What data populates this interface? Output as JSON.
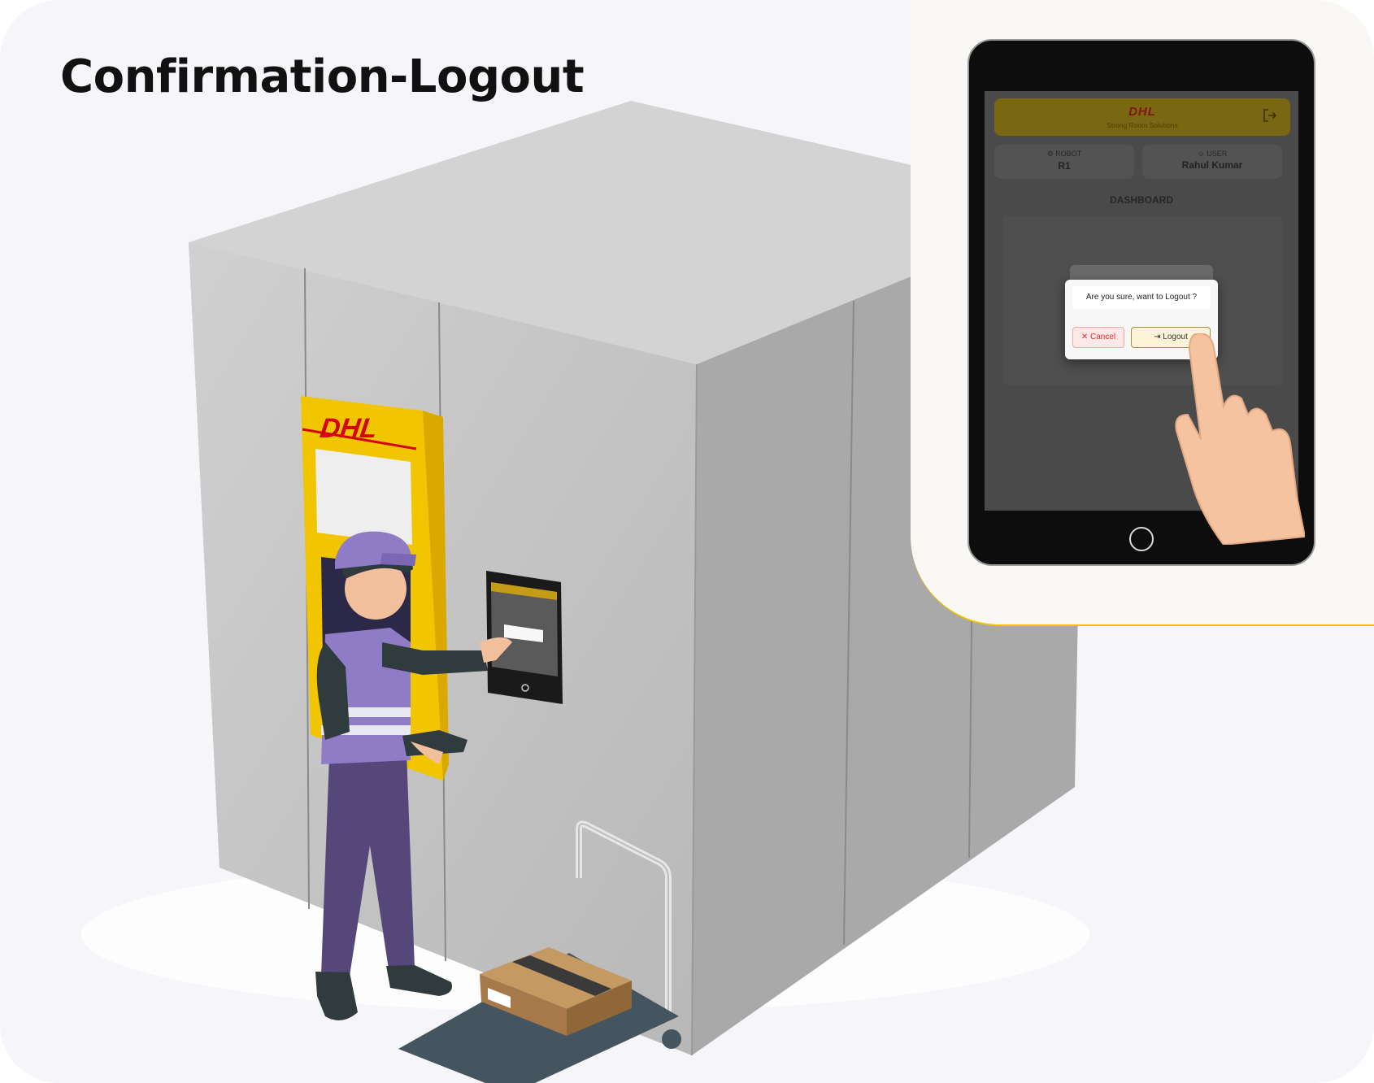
{
  "page": {
    "title": "Confirmation-Logout"
  },
  "kiosk": {
    "logo": "DHL"
  },
  "tablet": {
    "header": {
      "brand": "DHL",
      "subtitle": "Strong Room Solutions",
      "logout_icon": "logout-icon"
    },
    "robot": {
      "label": "ROBOT",
      "value": "R1",
      "icon": "robot-icon"
    },
    "user": {
      "label": "USER",
      "value": "Rahul Kumar",
      "icon": "user-icon"
    },
    "section_title": "DASHBOARD",
    "modal": {
      "message": "Are you sure, want to Logout ?",
      "cancel_label": "Cancel",
      "cancel_icon": "close-icon",
      "logout_label": "Logout",
      "logout_icon": "logout-icon"
    }
  },
  "colors": {
    "accent": "#ffcc00",
    "brand_red": "#d40511",
    "cancel": "#d63131"
  }
}
